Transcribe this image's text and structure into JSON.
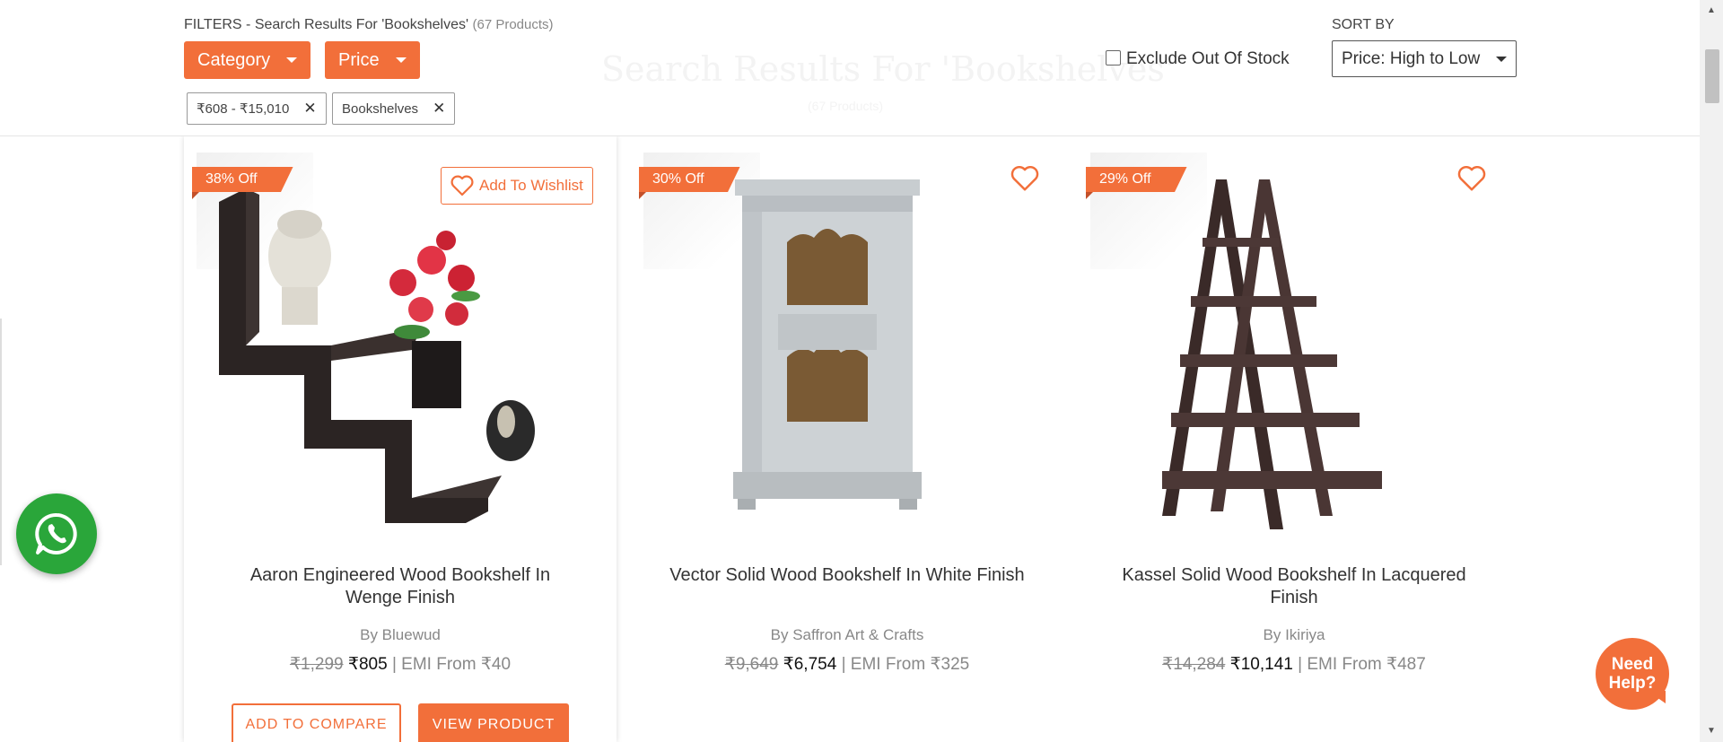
{
  "colors": {
    "accent": "#f26f3a",
    "whatsapp": "#2aa63a"
  },
  "filters": {
    "label": "FILTERS - Search Results For 'Bookshelves'",
    "count": "(67 Products)",
    "ghost_title": "Search Results For 'Bookshelves'",
    "ghost_sub": "(67 Products)",
    "category_label": "Category",
    "price_label": "Price",
    "active_chips": [
      {
        "label": "₹608 - ₹15,010"
      },
      {
        "label": "Bookshelves"
      }
    ],
    "exclude_out_of_stock": "Exclude Out Of Stock",
    "sort_by_label": "SORT BY",
    "sort_selected": "Price: High to Low"
  },
  "products": [
    {
      "discount": "38% Off",
      "wishlist_label": "Add To Wishlist",
      "name": "Aaron Engineered Wood Bookshelf In Wenge Finish",
      "brand": "By Bluewud",
      "mrp": "₹1,299",
      "price": "₹805",
      "emi": "| EMI From ₹40",
      "compare_label": "ADD TO COMPARE",
      "view_label": "VIEW PRODUCT"
    },
    {
      "discount": "30% Off",
      "name": "Vector Solid Wood Bookshelf In White Finish",
      "brand": "By Saffron Art & Crafts",
      "mrp": "₹9,649",
      "price": "₹6,754",
      "emi": "| EMI From ₹325"
    },
    {
      "discount": "29% Off",
      "name": "Kassel Solid Wood Bookshelf In Lacquered Finish",
      "brand": "By Ikiriya",
      "mrp": "₹14,284",
      "price": "₹10,141",
      "emi": "| EMI From ₹487"
    }
  ],
  "help": {
    "label": "Need Help?"
  },
  "icons": [
    "caret-down-icon",
    "close-icon",
    "heart-icon",
    "whatsapp-icon",
    "scroll-up-arrow-icon",
    "scroll-down-arrow-icon"
  ]
}
